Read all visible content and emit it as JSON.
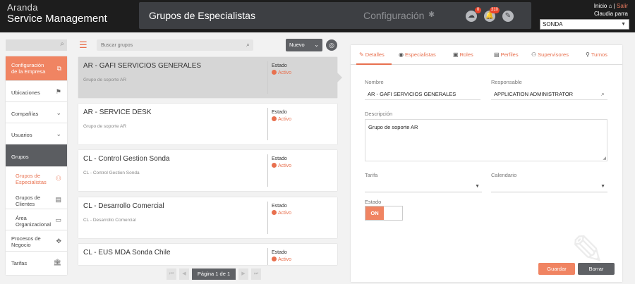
{
  "header": {
    "brand_line1": "Aranda",
    "brand_line2": "Service Management",
    "title": "Grupos de Especialistas",
    "section": "Configuración",
    "cloud_badge": "0",
    "bell_badge": "310",
    "home_label": "Inicio",
    "logout_label": "Salir",
    "user_name": "Claudia parra",
    "company": "SONDA"
  },
  "sidebar": {
    "items": [
      {
        "label": "Configuración de la Empresa",
        "icon": "puzzle-icon"
      },
      {
        "label": "Ubicaciones",
        "icon": "signpost-icon"
      },
      {
        "label": "Compañías",
        "icon": "chevron-down-icon"
      },
      {
        "label": "Usuarios",
        "icon": "chevron-down-icon"
      },
      {
        "label": "Grupos",
        "icon": ""
      },
      {
        "label": "Grupos de Especialistas",
        "icon": "group-icon"
      },
      {
        "label": "Grupos de Clientes",
        "icon": "client-group-icon"
      },
      {
        "label": "Área Organizacional",
        "icon": "org-area-icon"
      },
      {
        "label": "Procesos de Negocio",
        "icon": "process-icon"
      },
      {
        "label": "Tarifas",
        "icon": "bank-icon"
      }
    ]
  },
  "list": {
    "search_placeholder": "Buscar grupos",
    "new_label": "Nuevo",
    "status_label": "Estado",
    "groups": [
      {
        "name": "AR - GAFI SERVICIOS GENERALES",
        "desc": "Grupo de soporte AR",
        "status": "Activo"
      },
      {
        "name": "AR - SERVICE DESK",
        "desc": "Grupo de soporte AR",
        "status": "Activo"
      },
      {
        "name": "CL - Control Gestion Sonda",
        "desc": "CL - Control Gestion Sonda",
        "status": "Activo"
      },
      {
        "name": "CL - Desarrollo Comercial",
        "desc": "CL - Desarrollo Comercial",
        "status": "Activo"
      },
      {
        "name": "CL - EUS MDA Sonda Chile",
        "desc": "",
        "status": "Activo"
      }
    ],
    "pager_label": "Página 1 de 1"
  },
  "detail": {
    "tabs": [
      "Detalles",
      "Especialistas",
      "Roles",
      "Perfiles",
      "Supervisores",
      "Turnos"
    ],
    "name_label": "Nombre",
    "name_value": "AR - GAFI SERVICIOS GENERALES",
    "responsible_label": "Responsable",
    "responsible_value": "APPLICATION ADMINISTRATOR",
    "description_label": "Descripción",
    "description_value": "Grupo de soporte AR",
    "rate_label": "Tarifa",
    "rate_value": "",
    "calendar_label": "Calendario",
    "calendar_value": "",
    "status_label": "Estado",
    "toggle_on": "ON",
    "save_label": "Guardar",
    "delete_label": "Borrar"
  },
  "colors": {
    "accent": "#f08462",
    "dark": "#1d1d1d",
    "header_panel": "#3d3f43"
  }
}
